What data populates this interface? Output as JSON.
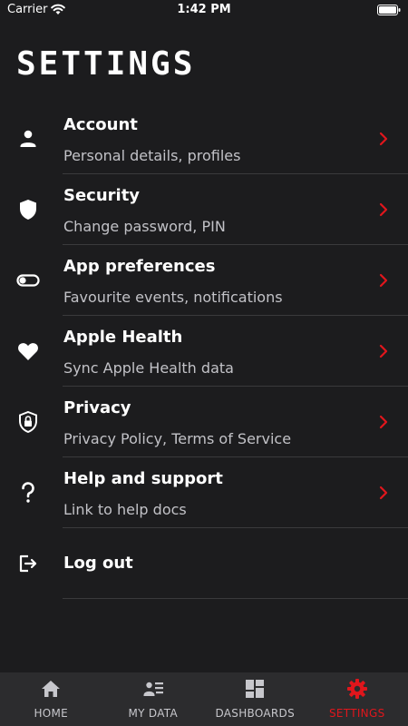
{
  "status_bar": {
    "carrier": "Carrier",
    "time": "1:42 PM"
  },
  "page": {
    "title": "SETTINGS"
  },
  "colors": {
    "accent": "#e0161c",
    "background": "#1c1c1e",
    "tabbar": "#2c2c2e"
  },
  "settings": {
    "items": [
      {
        "title": "Account",
        "subtitle": "Personal details, profiles",
        "icon": "person-icon"
      },
      {
        "title": "Security",
        "subtitle": "Change password, PIN",
        "icon": "shield-icon"
      },
      {
        "title": "App preferences",
        "subtitle": "Favourite events, notifications",
        "icon": "toggle-icon"
      },
      {
        "title": "Apple Health",
        "subtitle": "Sync Apple Health data",
        "icon": "heart-icon"
      },
      {
        "title": "Privacy",
        "subtitle": "Privacy Policy, Terms of Service",
        "icon": "shield-lock-icon"
      },
      {
        "title": "Help and support",
        "subtitle": "Link to help docs",
        "icon": "question-icon"
      }
    ],
    "logout": {
      "title": "Log out",
      "icon": "logout-icon"
    }
  },
  "tab_bar": {
    "tabs": [
      {
        "label": "HOME",
        "icon": "home-icon",
        "active": false
      },
      {
        "label": "MY DATA",
        "icon": "my-data-icon",
        "active": false
      },
      {
        "label": "DASHBOARDS",
        "icon": "dashboards-icon",
        "active": false
      },
      {
        "label": "SETTINGS",
        "icon": "gear-icon",
        "active": true
      }
    ]
  }
}
